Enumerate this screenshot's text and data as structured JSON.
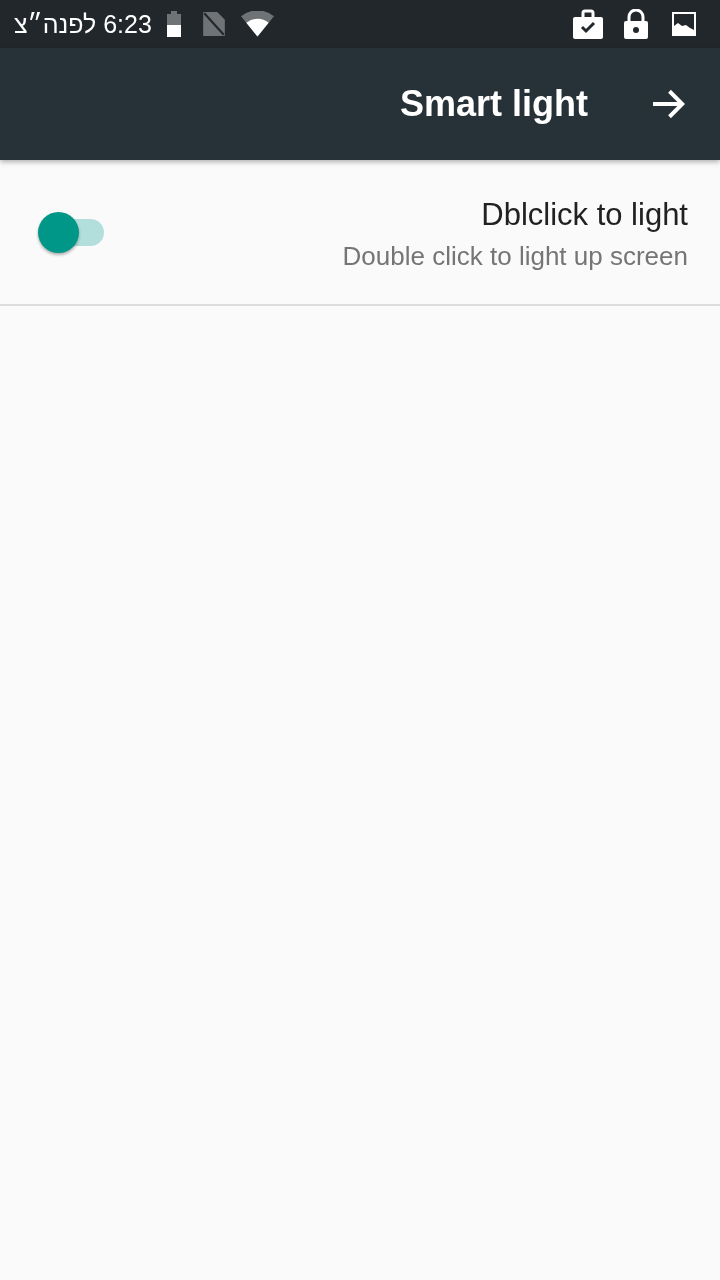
{
  "status_bar": {
    "time": "6:23 לפנה״צ"
  },
  "app_bar": {
    "title": "Smart light"
  },
  "settings": [
    {
      "title": "Dblclick to light",
      "summary": "Double click to light up screen",
      "on": true
    }
  ]
}
